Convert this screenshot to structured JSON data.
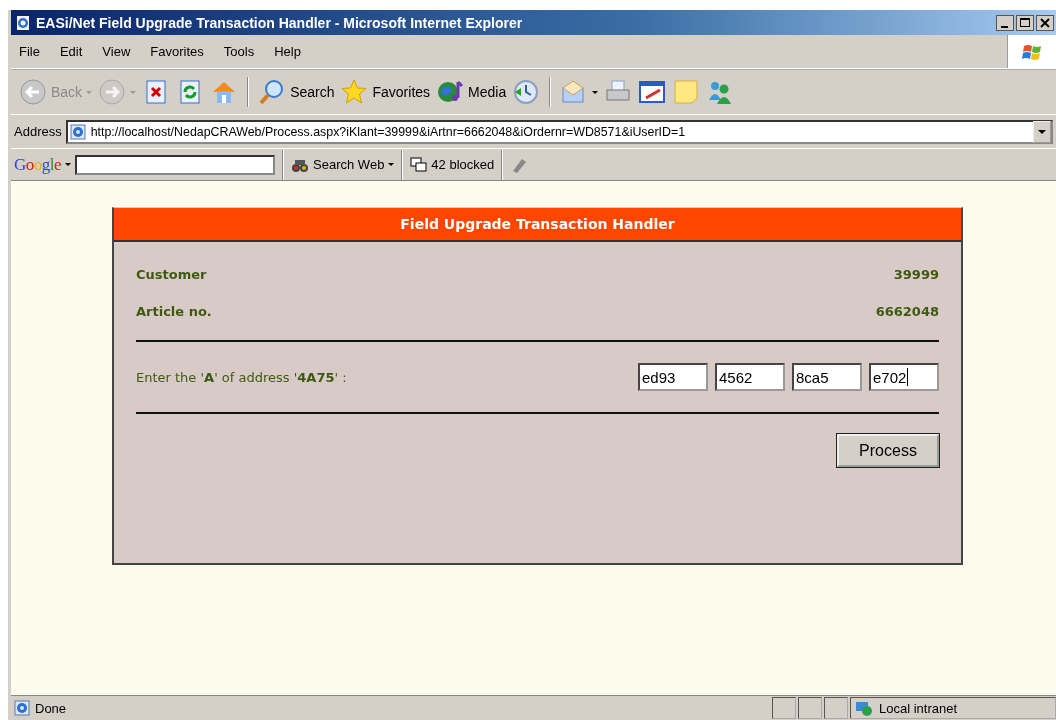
{
  "window": {
    "title": "EASi/Net Field Upgrade Transaction Handler - Microsoft Internet Explorer"
  },
  "menu": [
    {
      "label": "File"
    },
    {
      "label": "Edit"
    },
    {
      "label": "View"
    },
    {
      "label": "Favorites"
    },
    {
      "label": "Tools"
    },
    {
      "label": "Help"
    }
  ],
  "toolbar": [
    {
      "kind": "back",
      "label": "Back",
      "disabled": true,
      "dropdown": true
    },
    {
      "kind": "forward",
      "disabled": true,
      "dropdown": true
    },
    {
      "kind": "stop",
      "disabled": false,
      "dropdown": false
    },
    {
      "kind": "refresh",
      "disabled": false,
      "dropdown": false
    },
    {
      "kind": "home",
      "disabled": false,
      "dropdown": false
    },
    {
      "kind": "separator"
    },
    {
      "kind": "search",
      "label": "Search",
      "disabled": false,
      "dropdown": false
    },
    {
      "kind": "favorites",
      "label": "Favorites",
      "disabled": false,
      "dropdown": false
    },
    {
      "kind": "media",
      "label": "Media",
      "disabled": false,
      "dropdown": false
    },
    {
      "kind": "history",
      "disabled": false,
      "dropdown": false
    },
    {
      "kind": "separator"
    },
    {
      "kind": "mail",
      "disabled": false,
      "dropdown": true
    },
    {
      "kind": "print",
      "disabled": false,
      "dropdown": false
    },
    {
      "kind": "edit",
      "disabled": false,
      "dropdown": false
    },
    {
      "kind": "notes",
      "disabled": false,
      "dropdown": false
    },
    {
      "kind": "messenger",
      "disabled": false,
      "dropdown": false
    }
  ],
  "address_bar": {
    "label": "Address",
    "url": "http://localhost/NedapCRAWeb/Process.aspx?iKlant=39999&iArtnr=6662048&iOrdernr=WD8571&iUserID=1"
  },
  "google_toolbar": {
    "logo": "Google",
    "search_button": "Search Web",
    "popups": "42 blocked"
  },
  "page": {
    "header": "Field Upgrade Transaction Handler",
    "rows": [
      {
        "label": "Customer",
        "value": "39999"
      },
      {
        "label": "Article no.",
        "value": "6662048"
      }
    ],
    "prompt": "Enter the '**A**' of address '**4A75**' :",
    "inputs": [
      {
        "value": "ed93",
        "focused": false
      },
      {
        "value": "4562",
        "focused": false
      },
      {
        "value": "8ca5",
        "focused": false
      },
      {
        "value": "e702",
        "focused": true
      }
    ],
    "button": "Process"
  },
  "status_bar": {
    "text": "Done",
    "zone": "Local intranet"
  }
}
